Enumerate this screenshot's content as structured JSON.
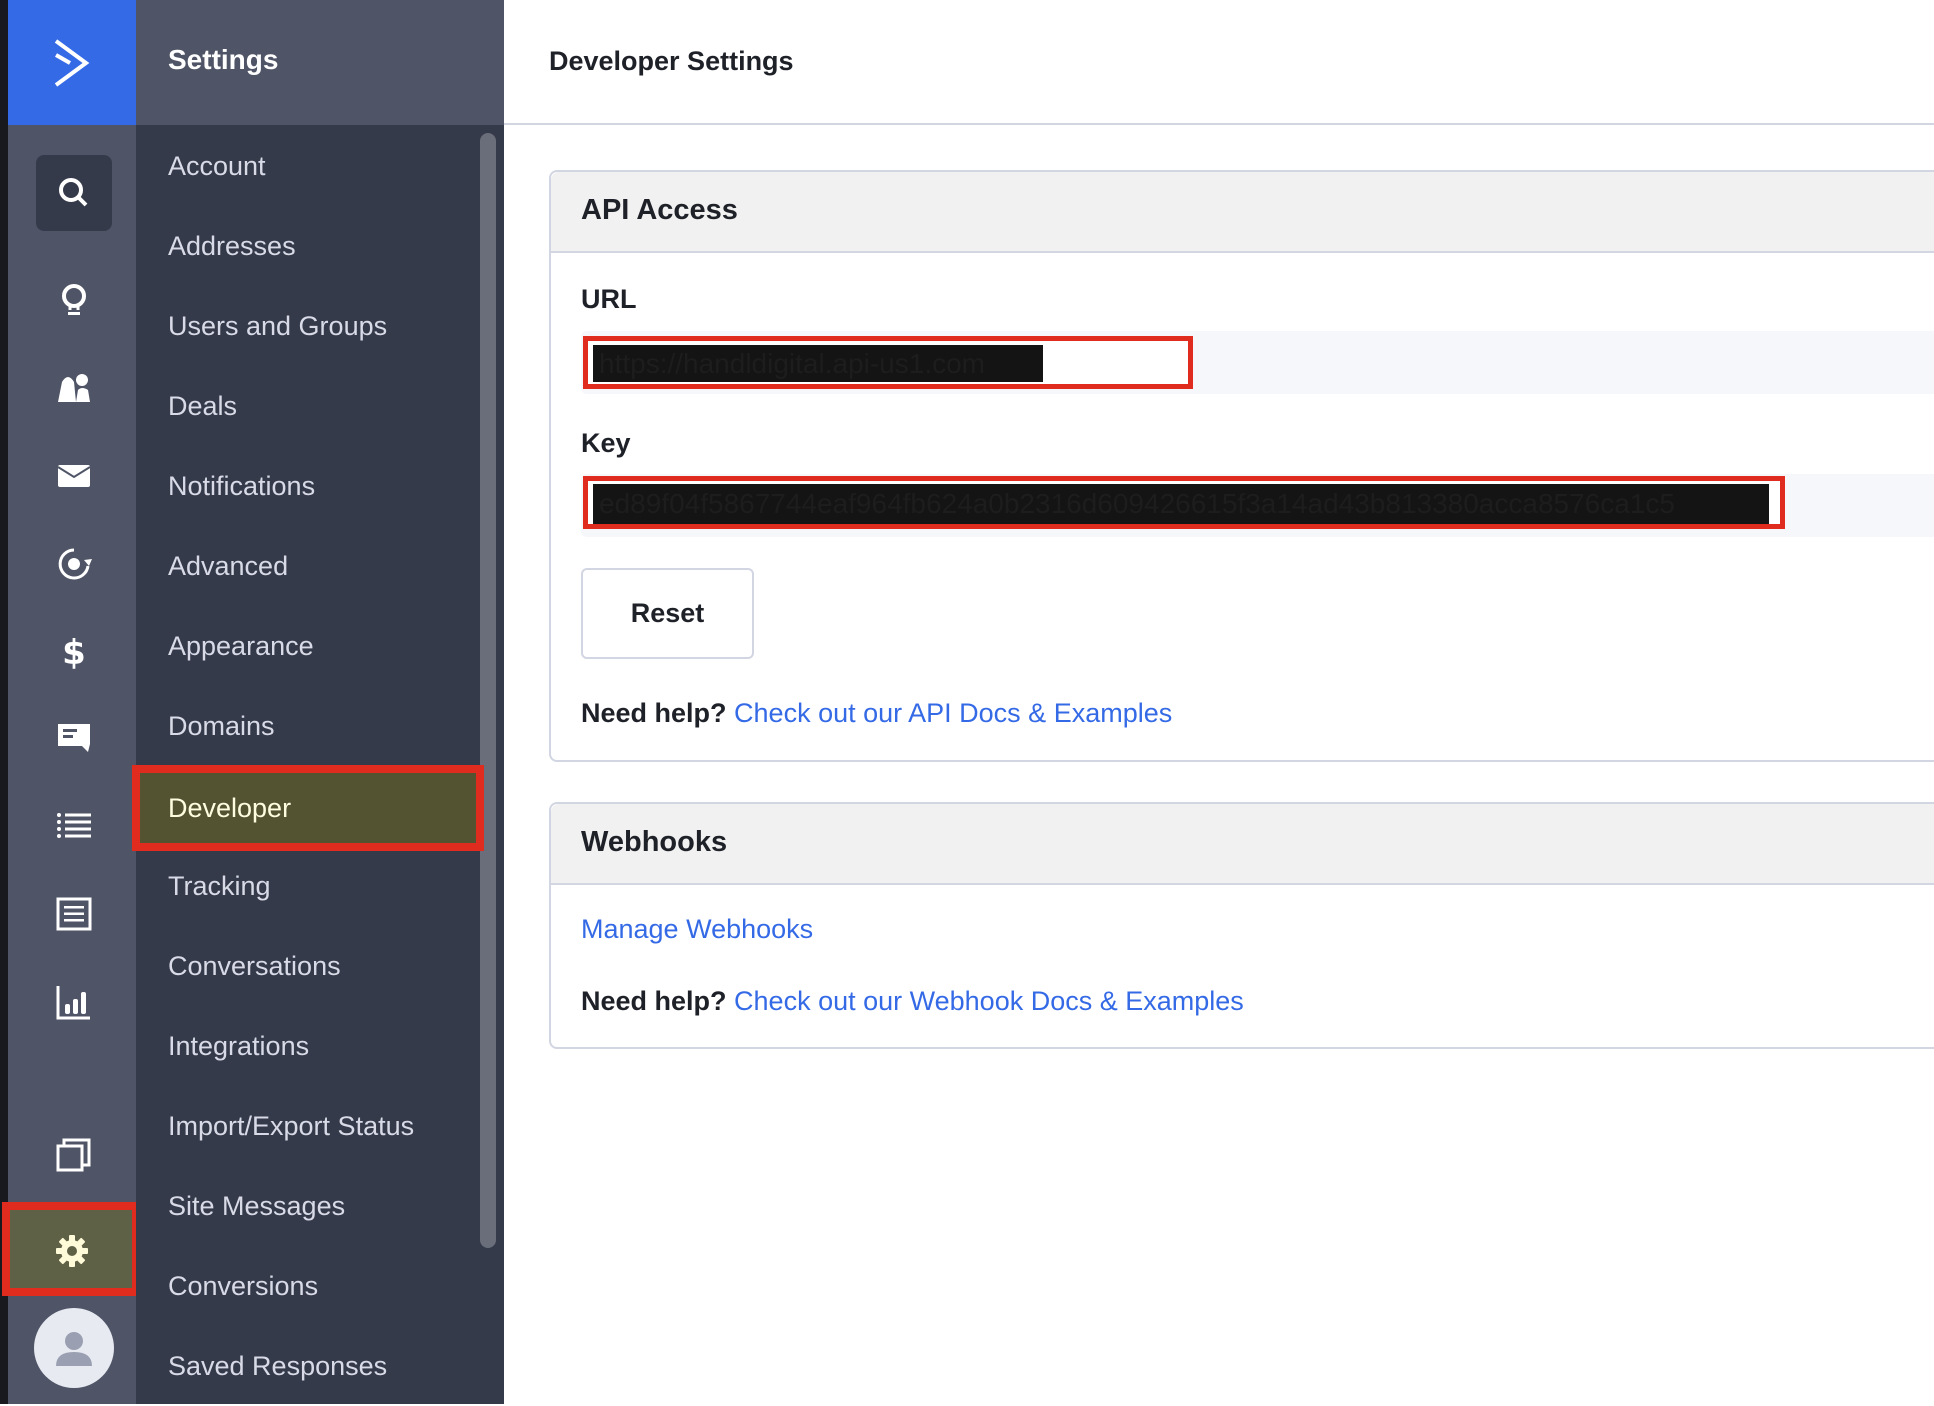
{
  "app": {
    "logo_icon": "activecampaign-chevron-icon",
    "brand_color": "#356ae6",
    "highlight_color": "#e02b1f"
  },
  "rail": {
    "icons": [
      {
        "name": "search-icon"
      },
      {
        "name": "lightbulb-icon"
      },
      {
        "name": "contacts-icon"
      },
      {
        "name": "envelope-icon"
      },
      {
        "name": "automation-icon"
      },
      {
        "name": "dollar-icon"
      },
      {
        "name": "conversations-icon"
      },
      {
        "name": "lists-icon"
      },
      {
        "name": "forms-icon"
      },
      {
        "name": "reports-icon"
      },
      {
        "name": "windows-icon"
      },
      {
        "name": "gear-icon",
        "active": true
      },
      {
        "name": "avatar-icon"
      }
    ]
  },
  "nav": {
    "title": "Settings",
    "items": [
      {
        "label": "Account"
      },
      {
        "label": "Addresses"
      },
      {
        "label": "Users and Groups"
      },
      {
        "label": "Deals"
      },
      {
        "label": "Notifications"
      },
      {
        "label": "Advanced"
      },
      {
        "label": "Appearance"
      },
      {
        "label": "Domains"
      },
      {
        "label": "Developer",
        "active": true
      },
      {
        "label": "Tracking"
      },
      {
        "label": "Conversations"
      },
      {
        "label": "Integrations"
      },
      {
        "label": "Import/Export Status"
      },
      {
        "label": "Site Messages"
      },
      {
        "label": "Conversions"
      },
      {
        "label": "Saved Responses"
      }
    ]
  },
  "main": {
    "title": "Developer Settings",
    "api": {
      "title": "API Access",
      "url_label": "URL",
      "url_value": "https://handldigital.api-us1.com",
      "key_label": "Key",
      "key_value": "ed89f04f5867744eaf964fb624a0b2316d609426615f3a14ad43b813380acca8576ca1c5",
      "reset_label": "Reset",
      "help_prefix": "Need help?",
      "help_link": "Check out our API Docs & Examples"
    },
    "webhooks": {
      "title": "Webhooks",
      "manage_link": "Manage Webhooks",
      "help_prefix": "Need help?",
      "help_link": "Check out our Webhook Docs & Examples"
    }
  }
}
